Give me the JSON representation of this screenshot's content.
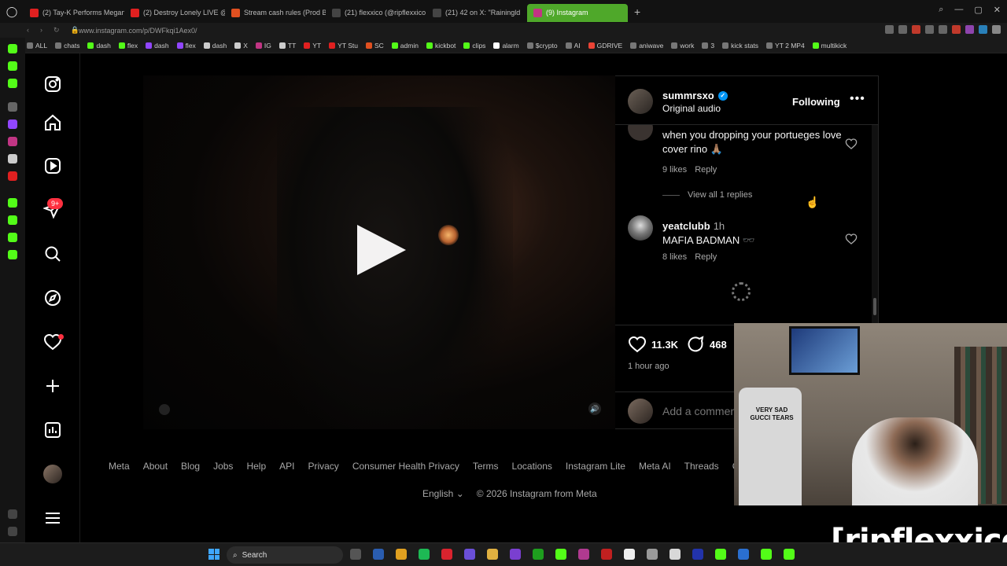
{
  "browser": {
    "tabs": [
      {
        "label": "(2) Tay-K Performs Megan",
        "fav": "#e02020"
      },
      {
        "label": "(2) Destroy Lonely LIVE @",
        "fav": "#e02020"
      },
      {
        "label": "Stream cash rules (Prod B",
        "fav": "#e05020"
      },
      {
        "label": "(21) flexxico (@ripflexxico",
        "fav": "#444444"
      },
      {
        "label": "(21) 42 on X: \"Rainingld",
        "fav": "#444444"
      },
      {
        "label": "(9) Instagram",
        "fav": "#c13584"
      }
    ],
    "url": "www.instagram.com/p/DWFkqi1Aex0/",
    "bookmarks": [
      {
        "label": "ALL",
        "color": "#777777"
      },
      {
        "label": "chats",
        "color": "#777777"
      },
      {
        "label": "dash",
        "color": "#53fc18"
      },
      {
        "label": "flex",
        "color": "#53fc18"
      },
      {
        "label": "dash",
        "color": "#9146ff"
      },
      {
        "label": "flex",
        "color": "#9146ff"
      },
      {
        "label": "dash",
        "color": "#cccccc"
      },
      {
        "label": "X",
        "color": "#cccccc"
      },
      {
        "label": "IG",
        "color": "#c13584"
      },
      {
        "label": "TT",
        "color": "#cccccc"
      },
      {
        "label": "YT",
        "color": "#e02020"
      },
      {
        "label": "YT Stu",
        "color": "#e02020"
      },
      {
        "label": "SC",
        "color": "#e05020"
      },
      {
        "label": "admin",
        "color": "#53fc18"
      },
      {
        "label": "kickbot",
        "color": "#53fc18"
      },
      {
        "label": "clips",
        "color": "#53fc18"
      },
      {
        "label": "alarm",
        "color": "#ffffff"
      },
      {
        "label": "$crypto",
        "color": "#777777"
      },
      {
        "label": "AI",
        "color": "#777777"
      },
      {
        "label": "GDRIVE",
        "color": "#ea4335"
      },
      {
        "label": "aniwave",
        "color": "#777777"
      },
      {
        "label": "work",
        "color": "#777777"
      },
      {
        "label": "3",
        "color": "#777777"
      },
      {
        "label": "kick stats",
        "color": "#777777"
      },
      {
        "label": "YT 2 MP4",
        "color": "#777777"
      },
      {
        "label": "multikick",
        "color": "#53fc18"
      }
    ]
  },
  "nav": {
    "notification_badge": "9+"
  },
  "post": {
    "username": "summrsxo",
    "audio": "Original audio",
    "follow_label": "Following",
    "more_label": "•••",
    "likes": "11.3K",
    "comments_count": "468",
    "time_ago": "1 hour ago",
    "add_comment_placeholder": "Add a comment..."
  },
  "comments": [
    {
      "text": "when you dropping your portueges love cover rino 🙏🏽",
      "likes": "9 likes",
      "reply": "Reply"
    },
    {
      "view_replies": "View all 1 replies"
    },
    {
      "user": "yeatclubb",
      "time": "1h",
      "text": "MAFIA BADMAN 🕶️",
      "likes": "8 likes",
      "reply": "Reply"
    }
  ],
  "footer": {
    "links": [
      "Meta",
      "About",
      "Blog",
      "Jobs",
      "Help",
      "API",
      "Privacy",
      "Consumer Health Privacy",
      "Terms",
      "Locations",
      "Instagram Lite",
      "Meta AI",
      "Threads",
      "Conta"
    ],
    "language": "English",
    "copyright": "© 2026 Instagram from Meta"
  },
  "stream": {
    "watermark": "[ripflexxico]",
    "shirt_text": "VERY SAD GUCCI TEARS"
  },
  "taskbar": {
    "search_label": "Search"
  }
}
